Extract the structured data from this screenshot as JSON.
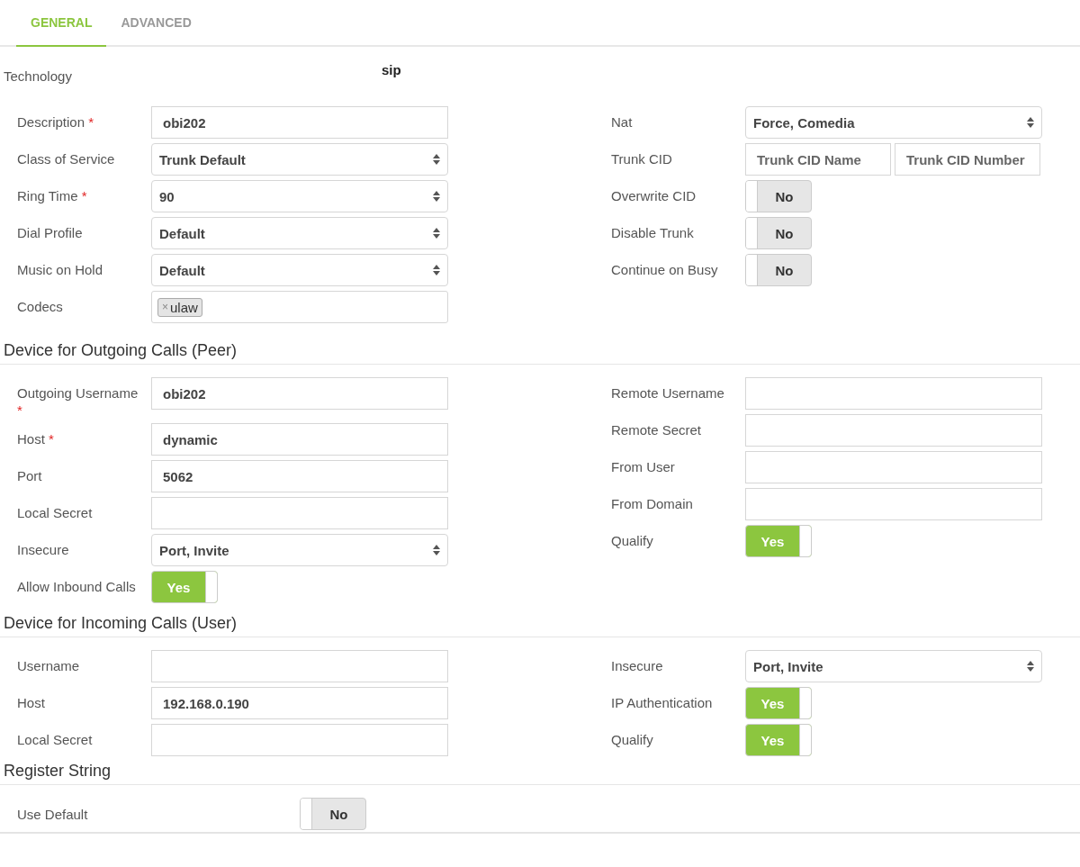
{
  "tabs": [
    {
      "label": "GENERAL",
      "selected": true
    },
    {
      "label": "ADVANCED",
      "selected": false
    }
  ],
  "technology": {
    "label": "Technology",
    "value": "sip"
  },
  "sections": [
    {
      "left": [
        {
          "kind": "text",
          "label": "Description",
          "required_mark": "*",
          "value": "obi202"
        },
        {
          "kind": "select",
          "label": "Class of Service",
          "value": "Trunk Default"
        },
        {
          "kind": "select",
          "label": "Ring Time",
          "required_mark": "*",
          "value": "90"
        },
        {
          "kind": "select",
          "label": "Dial Profile",
          "value": "Default"
        },
        {
          "kind": "select",
          "label": "Music on Hold",
          "value": "Default"
        },
        {
          "kind": "tags",
          "label": "Codecs",
          "tags": [
            {
              "remove": "×",
              "label": "ulaw"
            }
          ]
        }
      ],
      "right": [
        {
          "kind": "select",
          "label": "Nat",
          "value": "Force, Comedia"
        },
        {
          "kind": "pair",
          "label": "Trunk CID",
          "placeholders": [
            "Trunk CID Name",
            "Trunk CID Number"
          ]
        },
        {
          "kind": "toggle",
          "label": "Overwrite CID",
          "on": false,
          "text": "No"
        },
        {
          "kind": "toggle",
          "label": "Disable Trunk",
          "on": false,
          "text": "No"
        },
        {
          "kind": "toggle",
          "label": "Continue on Busy",
          "on": false,
          "text": "No"
        }
      ]
    },
    {
      "title": "Device for Outgoing Calls (Peer)",
      "left": [
        {
          "kind": "text",
          "label": "Outgoing Username",
          "required_mark": "*",
          "value": "obi202"
        },
        {
          "kind": "text",
          "label": "Host",
          "required_mark": "*",
          "value": "dynamic"
        },
        {
          "kind": "text",
          "label": "Port",
          "value": "5062"
        },
        {
          "kind": "text",
          "label": "Local Secret"
        },
        {
          "kind": "select",
          "label": "Insecure",
          "value": "Port, Invite"
        },
        {
          "kind": "toggle",
          "label": "Allow Inbound Calls",
          "on": true,
          "text": "Yes"
        }
      ],
      "right": [
        {
          "kind": "text",
          "label": "Remote Username"
        },
        {
          "kind": "text",
          "label": "Remote Secret"
        },
        {
          "kind": "text",
          "label": "From User"
        },
        {
          "kind": "text",
          "label": "From Domain"
        },
        {
          "kind": "toggle",
          "label": "Qualify",
          "on": true,
          "text": "Yes"
        }
      ]
    },
    {
      "title": "Device for Incoming Calls (User)",
      "left": [
        {
          "kind": "text",
          "label": "Username"
        },
        {
          "kind": "text",
          "label": "Host",
          "value": "192.168.0.190"
        },
        {
          "kind": "text",
          "label": "Local Secret"
        }
      ],
      "right": [
        {
          "kind": "select",
          "label": "Insecure",
          "value": "Port, Invite"
        },
        {
          "kind": "toggle",
          "label": "IP Authentication",
          "on": true,
          "text": "Yes"
        },
        {
          "kind": "toggle",
          "label": "Qualify",
          "on": true,
          "text": "Yes"
        }
      ]
    }
  ],
  "register_string": {
    "title": "Register String",
    "use_default": {
      "label": "Use Default",
      "on": false,
      "text": "No"
    }
  }
}
